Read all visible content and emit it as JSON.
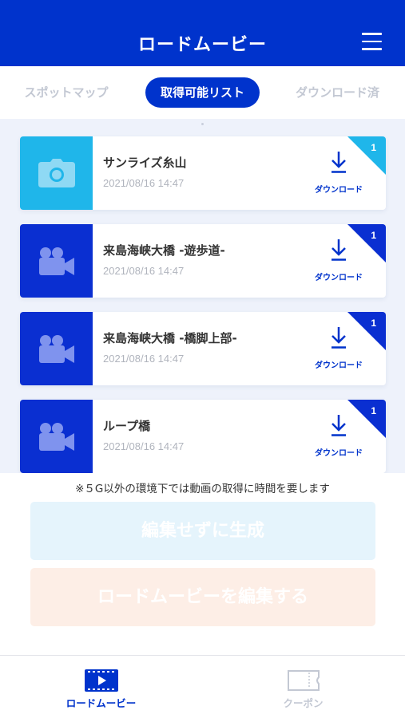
{
  "header": {
    "title": "ロードムービー",
    "menu_icon": "hamburger-menu-icon"
  },
  "tabs": [
    {
      "label": "スポットマップ",
      "active": false
    },
    {
      "label": "取得可能リスト",
      "active": true
    },
    {
      "label": "ダウンロード済",
      "active": false
    }
  ],
  "items": [
    {
      "title": "サンライズ糸山",
      "date": "2021/08/16 14:47",
      "badge": "1",
      "download_label": "ダウンロード",
      "icon": "camera-icon",
      "color": "#1fb6ea"
    },
    {
      "title": "来島海峡大橋 -遊歩道-",
      "date": "2021/08/16 14:47",
      "badge": "1",
      "download_label": "ダウンロード",
      "icon": "video-camera-icon",
      "color": "#0a2fd1"
    },
    {
      "title": "来島海峡大橋 -橋脚上部-",
      "date": "2021/08/16 14:47",
      "badge": "1",
      "download_label": "ダウンロード",
      "icon": "video-camera-icon",
      "color": "#0a2fd1"
    },
    {
      "title": "ループ橋",
      "date": "2021/08/16 14:47",
      "badge": "1",
      "download_label": "ダウンロード",
      "icon": "video-camera-icon",
      "color": "#0a2fd1"
    }
  ],
  "notice": "※５G以外の環境下では動画の取得に時間を要します",
  "actions": {
    "generate_label": "編集せずに生成",
    "edit_label": "ロードムービーを編集する"
  },
  "bottom_nav": [
    {
      "label": "ロードムービー",
      "icon": "film-play-icon",
      "active": true
    },
    {
      "label": "クーポン",
      "icon": "ticket-icon",
      "active": false
    }
  ],
  "colors": {
    "primary": "#0033cc",
    "photo_accent": "#1fb6ea",
    "video_accent": "#0a2fd1",
    "inactive": "#c3c8d3"
  }
}
